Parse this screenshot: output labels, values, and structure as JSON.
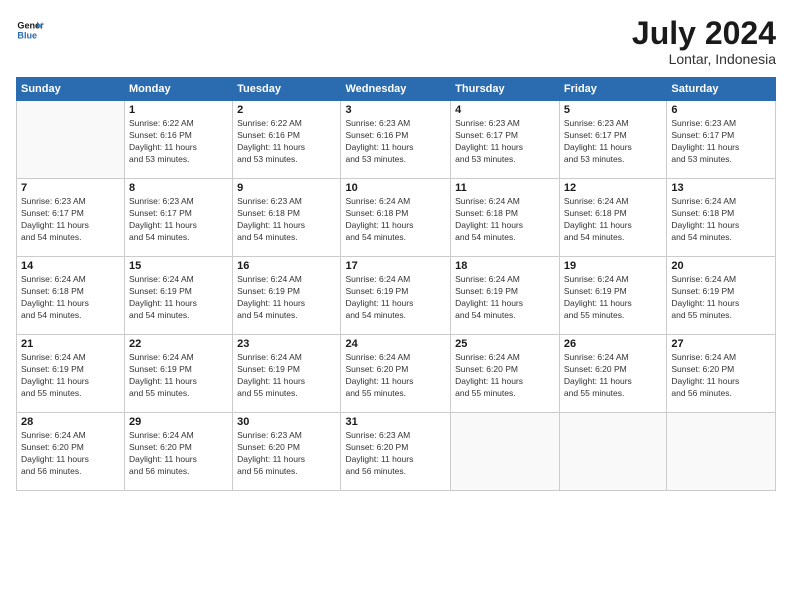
{
  "logo": {
    "text_general": "General",
    "text_blue": "Blue"
  },
  "header": {
    "month_year": "July 2024",
    "location": "Lontar, Indonesia"
  },
  "days_of_week": [
    "Sunday",
    "Monday",
    "Tuesday",
    "Wednesday",
    "Thursday",
    "Friday",
    "Saturday"
  ],
  "weeks": [
    [
      {
        "day": "",
        "empty": true
      },
      {
        "day": "1",
        "sunrise": "Sunrise: 6:22 AM",
        "sunset": "Sunset: 6:16 PM",
        "daylight": "Daylight: 11 hours",
        "minutes": "and 53 minutes."
      },
      {
        "day": "2",
        "sunrise": "Sunrise: 6:22 AM",
        "sunset": "Sunset: 6:16 PM",
        "daylight": "Daylight: 11 hours",
        "minutes": "and 53 minutes."
      },
      {
        "day": "3",
        "sunrise": "Sunrise: 6:23 AM",
        "sunset": "Sunset: 6:16 PM",
        "daylight": "Daylight: 11 hours",
        "minutes": "and 53 minutes."
      },
      {
        "day": "4",
        "sunrise": "Sunrise: 6:23 AM",
        "sunset": "Sunset: 6:17 PM",
        "daylight": "Daylight: 11 hours",
        "minutes": "and 53 minutes."
      },
      {
        "day": "5",
        "sunrise": "Sunrise: 6:23 AM",
        "sunset": "Sunset: 6:17 PM",
        "daylight": "Daylight: 11 hours",
        "minutes": "and 53 minutes."
      },
      {
        "day": "6",
        "sunrise": "Sunrise: 6:23 AM",
        "sunset": "Sunset: 6:17 PM",
        "daylight": "Daylight: 11 hours",
        "minutes": "and 53 minutes."
      }
    ],
    [
      {
        "day": "7",
        "sunrise": "Sunrise: 6:23 AM",
        "sunset": "Sunset: 6:17 PM",
        "daylight": "Daylight: 11 hours",
        "minutes": "and 54 minutes."
      },
      {
        "day": "8",
        "sunrise": "Sunrise: 6:23 AM",
        "sunset": "Sunset: 6:17 PM",
        "daylight": "Daylight: 11 hours",
        "minutes": "and 54 minutes."
      },
      {
        "day": "9",
        "sunrise": "Sunrise: 6:23 AM",
        "sunset": "Sunset: 6:18 PM",
        "daylight": "Daylight: 11 hours",
        "minutes": "and 54 minutes."
      },
      {
        "day": "10",
        "sunrise": "Sunrise: 6:24 AM",
        "sunset": "Sunset: 6:18 PM",
        "daylight": "Daylight: 11 hours",
        "minutes": "and 54 minutes."
      },
      {
        "day": "11",
        "sunrise": "Sunrise: 6:24 AM",
        "sunset": "Sunset: 6:18 PM",
        "daylight": "Daylight: 11 hours",
        "minutes": "and 54 minutes."
      },
      {
        "day": "12",
        "sunrise": "Sunrise: 6:24 AM",
        "sunset": "Sunset: 6:18 PM",
        "daylight": "Daylight: 11 hours",
        "minutes": "and 54 minutes."
      },
      {
        "day": "13",
        "sunrise": "Sunrise: 6:24 AM",
        "sunset": "Sunset: 6:18 PM",
        "daylight": "Daylight: 11 hours",
        "minutes": "and 54 minutes."
      }
    ],
    [
      {
        "day": "14",
        "sunrise": "Sunrise: 6:24 AM",
        "sunset": "Sunset: 6:18 PM",
        "daylight": "Daylight: 11 hours",
        "minutes": "and 54 minutes."
      },
      {
        "day": "15",
        "sunrise": "Sunrise: 6:24 AM",
        "sunset": "Sunset: 6:19 PM",
        "daylight": "Daylight: 11 hours",
        "minutes": "and 54 minutes."
      },
      {
        "day": "16",
        "sunrise": "Sunrise: 6:24 AM",
        "sunset": "Sunset: 6:19 PM",
        "daylight": "Daylight: 11 hours",
        "minutes": "and 54 minutes."
      },
      {
        "day": "17",
        "sunrise": "Sunrise: 6:24 AM",
        "sunset": "Sunset: 6:19 PM",
        "daylight": "Daylight: 11 hours",
        "minutes": "and 54 minutes."
      },
      {
        "day": "18",
        "sunrise": "Sunrise: 6:24 AM",
        "sunset": "Sunset: 6:19 PM",
        "daylight": "Daylight: 11 hours",
        "minutes": "and 54 minutes."
      },
      {
        "day": "19",
        "sunrise": "Sunrise: 6:24 AM",
        "sunset": "Sunset: 6:19 PM",
        "daylight": "Daylight: 11 hours",
        "minutes": "and 55 minutes."
      },
      {
        "day": "20",
        "sunrise": "Sunrise: 6:24 AM",
        "sunset": "Sunset: 6:19 PM",
        "daylight": "Daylight: 11 hours",
        "minutes": "and 55 minutes."
      }
    ],
    [
      {
        "day": "21",
        "sunrise": "Sunrise: 6:24 AM",
        "sunset": "Sunset: 6:19 PM",
        "daylight": "Daylight: 11 hours",
        "minutes": "and 55 minutes."
      },
      {
        "day": "22",
        "sunrise": "Sunrise: 6:24 AM",
        "sunset": "Sunset: 6:19 PM",
        "daylight": "Daylight: 11 hours",
        "minutes": "and 55 minutes."
      },
      {
        "day": "23",
        "sunrise": "Sunrise: 6:24 AM",
        "sunset": "Sunset: 6:19 PM",
        "daylight": "Daylight: 11 hours",
        "minutes": "and 55 minutes."
      },
      {
        "day": "24",
        "sunrise": "Sunrise: 6:24 AM",
        "sunset": "Sunset: 6:20 PM",
        "daylight": "Daylight: 11 hours",
        "minutes": "and 55 minutes."
      },
      {
        "day": "25",
        "sunrise": "Sunrise: 6:24 AM",
        "sunset": "Sunset: 6:20 PM",
        "daylight": "Daylight: 11 hours",
        "minutes": "and 55 minutes."
      },
      {
        "day": "26",
        "sunrise": "Sunrise: 6:24 AM",
        "sunset": "Sunset: 6:20 PM",
        "daylight": "Daylight: 11 hours",
        "minutes": "and 55 minutes."
      },
      {
        "day": "27",
        "sunrise": "Sunrise: 6:24 AM",
        "sunset": "Sunset: 6:20 PM",
        "daylight": "Daylight: 11 hours",
        "minutes": "and 56 minutes."
      }
    ],
    [
      {
        "day": "28",
        "sunrise": "Sunrise: 6:24 AM",
        "sunset": "Sunset: 6:20 PM",
        "daylight": "Daylight: 11 hours",
        "minutes": "and 56 minutes."
      },
      {
        "day": "29",
        "sunrise": "Sunrise: 6:24 AM",
        "sunset": "Sunset: 6:20 PM",
        "daylight": "Daylight: 11 hours",
        "minutes": "and 56 minutes."
      },
      {
        "day": "30",
        "sunrise": "Sunrise: 6:23 AM",
        "sunset": "Sunset: 6:20 PM",
        "daylight": "Daylight: 11 hours",
        "minutes": "and 56 minutes."
      },
      {
        "day": "31",
        "sunrise": "Sunrise: 6:23 AM",
        "sunset": "Sunset: 6:20 PM",
        "daylight": "Daylight: 11 hours",
        "minutes": "and 56 minutes."
      },
      {
        "day": "",
        "empty": true
      },
      {
        "day": "",
        "empty": true
      },
      {
        "day": "",
        "empty": true
      }
    ]
  ]
}
